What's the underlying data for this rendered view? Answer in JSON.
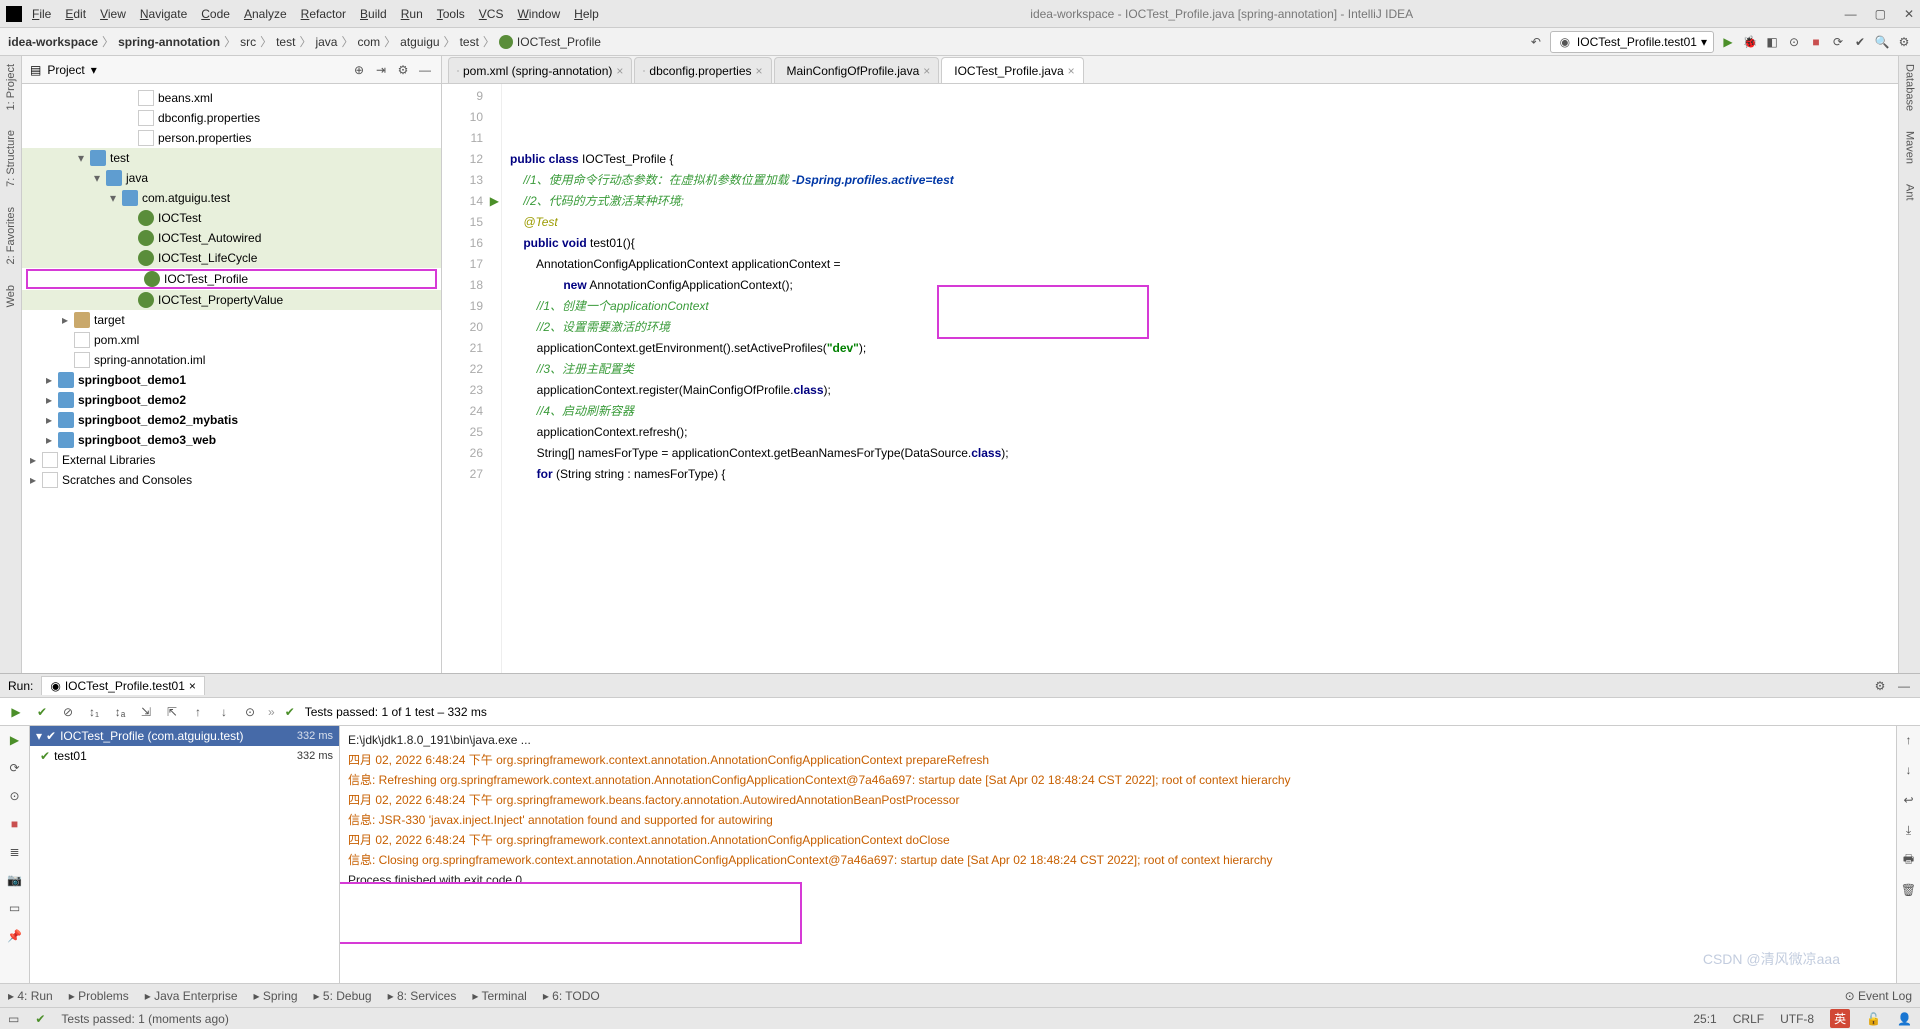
{
  "title": "idea-workspace - IOCTest_Profile.java [spring-annotation] - IntelliJ IDEA",
  "menus": [
    "File",
    "Edit",
    "View",
    "Navigate",
    "Code",
    "Analyze",
    "Refactor",
    "Build",
    "Run",
    "Tools",
    "VCS",
    "Window",
    "Help"
  ],
  "breadcrumb": [
    "idea-workspace",
    "spring-annotation",
    "src",
    "test",
    "java",
    "com",
    "atguigu",
    "test",
    "IOCTest_Profile"
  ],
  "run_config_selected": "IOCTest_Profile.test01",
  "project_panel": {
    "title": "Project",
    "tree": [
      {
        "indent": 6,
        "icon": "xml",
        "label": "beans.xml",
        "arrow": ""
      },
      {
        "indent": 6,
        "icon": "prop",
        "label": "dbconfig.properties",
        "arrow": ""
      },
      {
        "indent": 6,
        "icon": "prop",
        "label": "person.properties",
        "arrow": ""
      },
      {
        "indent": 3,
        "icon": "folder-blue",
        "label": "test",
        "arrow": "▾",
        "bg": "green"
      },
      {
        "indent": 4,
        "icon": "folder-blue",
        "label": "java",
        "arrow": "▾",
        "bg": "green"
      },
      {
        "indent": 5,
        "icon": "folder-blue",
        "label": "com.atguigu.test",
        "arrow": "▾",
        "bg": "green"
      },
      {
        "indent": 6,
        "icon": "class",
        "label": "IOCTest",
        "arrow": "",
        "bg": "green"
      },
      {
        "indent": 6,
        "icon": "class",
        "label": "IOCTest_Autowired",
        "arrow": "",
        "bg": "green"
      },
      {
        "indent": 6,
        "icon": "class",
        "label": "IOCTest_LifeCycle",
        "arrow": "",
        "bg": "green"
      },
      {
        "indent": 6,
        "icon": "class",
        "label": "IOCTest_Profile",
        "arrow": "",
        "sel": true
      },
      {
        "indent": 6,
        "icon": "class",
        "label": "IOCTest_PropertyValue",
        "arrow": "",
        "bg": "green"
      },
      {
        "indent": 2,
        "icon": "folder",
        "label": "target",
        "arrow": "▸"
      },
      {
        "indent": 2,
        "icon": "maven",
        "label": "pom.xml",
        "arrow": ""
      },
      {
        "indent": 2,
        "icon": "xml",
        "label": "spring-annotation.iml",
        "arrow": ""
      },
      {
        "indent": 1,
        "icon": "folder-blue",
        "label": "springboot_demo1",
        "arrow": "▸",
        "bold": true
      },
      {
        "indent": 1,
        "icon": "folder-blue",
        "label": "springboot_demo2",
        "arrow": "▸",
        "bold": true
      },
      {
        "indent": 1,
        "icon": "folder-blue",
        "label": "springboot_demo2_mybatis",
        "arrow": "▸",
        "bold": true
      },
      {
        "indent": 1,
        "icon": "folder-blue",
        "label": "springboot_demo3_web",
        "arrow": "▸",
        "bold": true
      },
      {
        "indent": 0,
        "icon": "lib",
        "label": "External Libraries",
        "arrow": "▸"
      },
      {
        "indent": 0,
        "icon": "lib",
        "label": "Scratches and Consoles",
        "arrow": "▸"
      }
    ]
  },
  "left_gutter": [
    "1: Project",
    "7: Structure",
    "2: Favorites",
    "Web"
  ],
  "right_gutter": [
    "Database",
    "Maven",
    "Ant"
  ],
  "editor": {
    "tabs": [
      {
        "label": "pom.xml (spring-annotation)",
        "icon": "maven"
      },
      {
        "label": "dbconfig.properties",
        "icon": "prop"
      },
      {
        "label": "MainConfigOfProfile.java",
        "icon": "class"
      },
      {
        "label": "IOCTest_Profile.java",
        "icon": "class",
        "active": true
      }
    ],
    "lines": [
      {
        "n": 9,
        "html": "<span class='kw'>public class</span> IOCTest_Profile {"
      },
      {
        "n": 10,
        "html": ""
      },
      {
        "n": 11,
        "html": "    <span class='cmg'>//1、使用命令行动态参数：在虚拟机参数位置加载 <span class='cmb'>-Dspring.profiles.active=test</span></span>"
      },
      {
        "n": 12,
        "html": "    <span class='cmg'>//2、代码的方式激活某种环境;</span>"
      },
      {
        "n": 13,
        "html": "    <span class='ann'>@Test</span>"
      },
      {
        "n": 14,
        "html": "    <span class='kw'>public void</span> test01(){",
        "icon": "run"
      },
      {
        "n": 15,
        "html": "        AnnotationConfigApplicationContext applicationContext ="
      },
      {
        "n": 16,
        "html": "                <span class='kw'>new</span> AnnotationConfigApplicationContext();"
      },
      {
        "n": 17,
        "html": ""
      },
      {
        "n": 18,
        "html": "        <span class='cmg'>//1、创建一个applicationContext</span>"
      },
      {
        "n": 19,
        "html": "        <span class='cmg'>//2、设置需要激活的环境</span>"
      },
      {
        "n": 20,
        "html": "        applicationContext.getEnvironment().setActiveProfiles(<span class='str'>\"dev\"</span>);"
      },
      {
        "n": 21,
        "html": "        <span class='cmg'>//3、注册主配置类</span>"
      },
      {
        "n": 22,
        "html": "        applicationContext.register(MainConfigOfProfile.<span class='kw'>class</span>);"
      },
      {
        "n": 23,
        "html": "        <span class='cmg'>//4、启动刷新容器</span>"
      },
      {
        "n": 24,
        "html": "        applicationContext.refresh();"
      },
      {
        "n": 25,
        "html": ""
      },
      {
        "n": 26,
        "html": "        String[] namesForType = applicationContext.getBeanNamesForType(DataSource.<span class='kw'>class</span>);"
      },
      {
        "n": 27,
        "html": "        <span class='kw'>for</span> (String string : namesForType) {"
      }
    ]
  },
  "run": {
    "title": "Run:",
    "tab": "IOCTest_Profile.test01",
    "status": "Tests passed: 1 of 1 test – 332 ms",
    "tree": [
      {
        "label": "IOCTest_Profile (com.atguigu.test)",
        "time": "332 ms",
        "hdr": true
      },
      {
        "label": "test01",
        "time": "332 ms"
      }
    ],
    "output": [
      {
        "cls": "norm",
        "text": "E:\\jdk\\jdk1.8.0_191\\bin\\java.exe ..."
      },
      {
        "cls": "info",
        "text": "四月 02, 2022 6:48:24 下午 org.springframework.context.annotation.AnnotationConfigApplicationContext prepareRefresh"
      },
      {
        "cls": "info",
        "text": "信息: Refreshing org.springframework.context.annotation.AnnotationConfigApplicationContext@7a46a697: startup date [Sat Apr 02 18:48:24 CST 2022]; root of context hierarchy"
      },
      {
        "cls": "info",
        "text": "四月 02, 2022 6:48:24 下午 org.springframework.beans.factory.annotation.AutowiredAnnotationBeanPostProcessor <init>"
      },
      {
        "cls": "info",
        "text": "信息: JSR-330 'javax.inject.Inject' annotation found and supported for autowiring"
      },
      {
        "cls": "info",
        "text": "四月 02, 2022 6:48:24 下午 org.springframework.context.annotation.AnnotationConfigApplicationContext doClose"
      },
      {
        "cls": "info",
        "text": "信息: Closing org.springframework.context.annotation.AnnotationConfigApplicationContext@7a46a697: startup date [Sat Apr 02 18:48:24 CST 2022]; root of context hierarchy"
      },
      {
        "cls": "norm",
        "text": ""
      },
      {
        "cls": "norm",
        "text": "Process finished with exit code 0"
      }
    ]
  },
  "bottom_tabs": [
    "4: Run",
    "Problems",
    "Java Enterprise",
    "Spring",
    "5: Debug",
    "8: Services",
    "Terminal",
    "6: TODO"
  ],
  "bottom_right": "Event Log",
  "status": {
    "left": "Tests passed: 1 (moments ago)",
    "pos": "25:1",
    "enc": "CRLF",
    "charset": "UTF-8"
  },
  "watermark": "CSDN @清风微凉aaa"
}
